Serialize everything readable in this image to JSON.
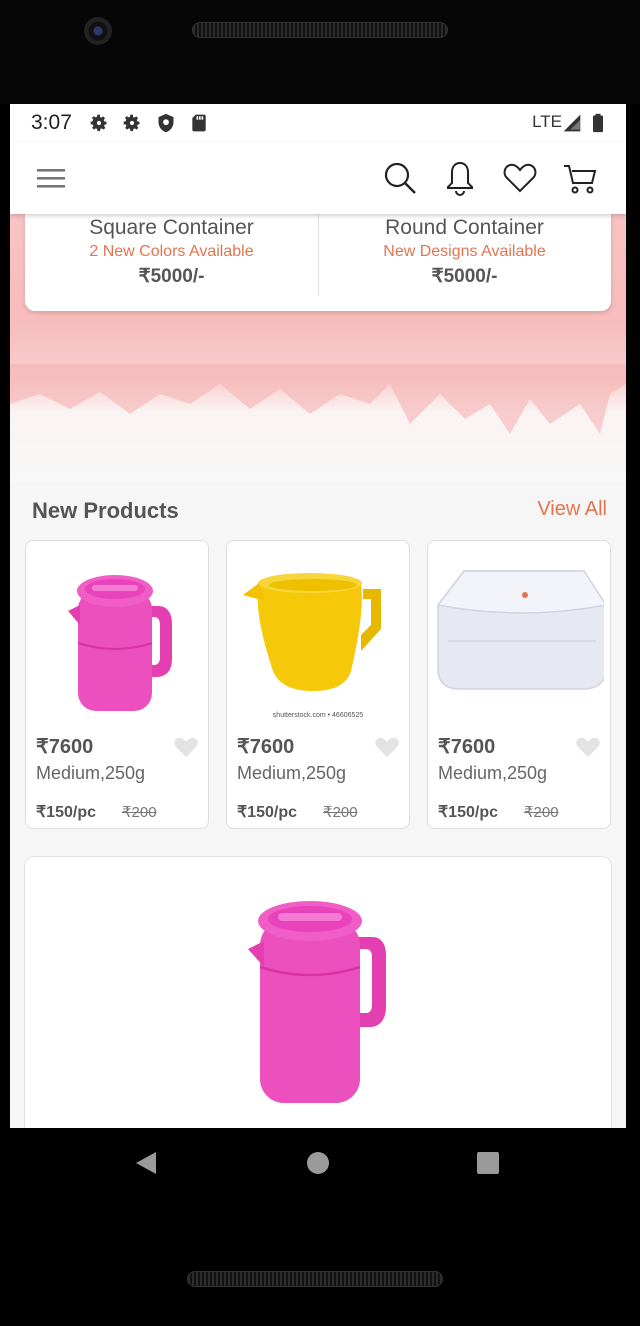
{
  "status_bar": {
    "time": "3:07",
    "network": "LTE",
    "icons": [
      "gear-icon",
      "gear-icon",
      "shield-icon",
      "sd-card-icon",
      "signal-icon",
      "battery-icon"
    ]
  },
  "app_bar": {
    "icons": [
      "menu-icon",
      "search-icon",
      "bell-icon",
      "heart-icon",
      "cart-icon"
    ]
  },
  "categories": [
    {
      "name": "Square Container",
      "subtitle": "2 New Colors Available",
      "price": "₹5000/-"
    },
    {
      "name": "Round Container",
      "subtitle": "New Designs Available",
      "price": "₹5000/-"
    }
  ],
  "new_products": {
    "title": "New Products",
    "view_all": "View All",
    "items": [
      {
        "price": "₹7600",
        "desc": "Medium,250g",
        "unit_price": "₹150/pc",
        "old_price": "₹200",
        "image": "pink-jug"
      },
      {
        "price": "₹7600",
        "desc": "Medium,250g",
        "unit_price": "₹150/pc",
        "old_price": "₹200",
        "image": "yellow-mug",
        "watermark": "shutterstock.com • 46606525"
      },
      {
        "price": "₹7600",
        "desc": "Medium,250g",
        "unit_price": "₹150/pc",
        "old_price": "₹200",
        "image": "clear-container"
      }
    ]
  },
  "featured": {
    "image": "pink-jug"
  },
  "colors": {
    "accent": "#e2754f",
    "text": "#555555",
    "banner": "#f7bcbc"
  },
  "nav": {
    "icons": [
      "back-icon",
      "home-icon",
      "recents-icon"
    ]
  }
}
